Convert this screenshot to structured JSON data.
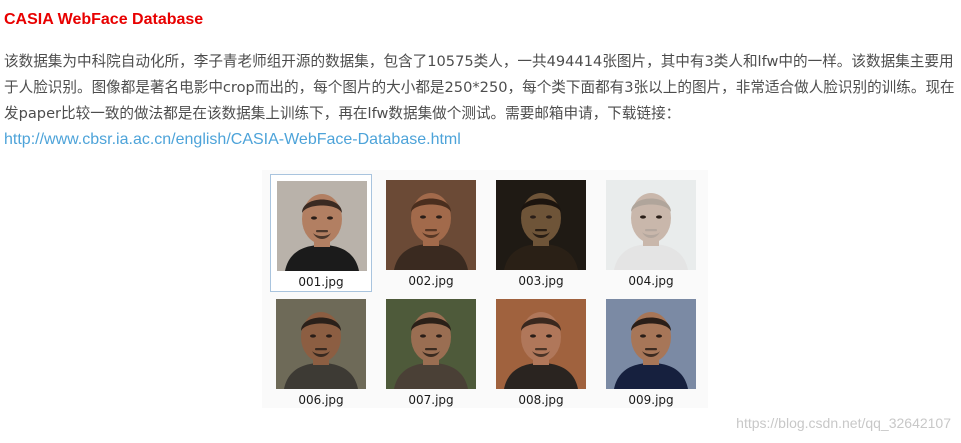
{
  "title": "CASIA WebFace Database",
  "paragraph": {
    "text": "该数据集为中科院自动化所，李子青老师组开源的数据集，包含了10575类人，一共494414张图片，其中有3类人和lfw中的一样。该数据集主要用于人脸识别。图像都是著名电影中crop而出的，每个图片的大小都是250*250，每个类下面都有3张以上的图片，非常适合做人脸识别的训练。现在发paper比较一致的做法都是在该数据集上训练下，再在lfw数据集做个测试。需要邮箱申请，下载链接：",
    "link_text": "http://www.cbsr.ia.ac.cn/english/CASIA-WebFace-Database.html"
  },
  "gallery": {
    "files": [
      {
        "name": "001.jpg",
        "selected": true,
        "bg": "#b9b2aa",
        "skin": "#b27f62",
        "hair": "#3a2a22",
        "shirt": "#1b1b1b"
      },
      {
        "name": "002.jpg",
        "selected": false,
        "bg": "#6b4a36",
        "skin": "#a26a4b",
        "hair": "#4a2e1e",
        "shirt": "#3a2a20"
      },
      {
        "name": "003.jpg",
        "selected": false,
        "bg": "#1f1a14",
        "skin": "#6e5438",
        "hair": "#1c140e",
        "shirt": "#2a2016"
      },
      {
        "name": "004.jpg",
        "selected": false,
        "bg": "#e9ecec",
        "skin": "#c9b7ab",
        "hair": "#b0a59b",
        "shirt": "#e4e4e4"
      },
      {
        "name": "006.jpg",
        "selected": false,
        "bg": "#6e6a58",
        "skin": "#8c5e42",
        "hair": "#2a201a",
        "shirt": "#3d3a34"
      },
      {
        "name": "007.jpg",
        "selected": false,
        "bg": "#4e5a3a",
        "skin": "#9a6e52",
        "hair": "#2a2018",
        "shirt": "#4a4036"
      },
      {
        "name": "008.jpg",
        "selected": false,
        "bg": "#a0623e",
        "skin": "#b0775a",
        "hair": "#3a281e",
        "shirt": "#2a2420"
      },
      {
        "name": "009.jpg",
        "selected": false,
        "bg": "#7b8aa4",
        "skin": "#a77658",
        "hair": "#2a1e18",
        "shirt": "#16203e"
      }
    ]
  },
  "watermark": "https://blog.csdn.net/qq_32642107",
  "colors": {
    "title": "#e80000",
    "body_text": "#4d4d4d",
    "link": "#4da3d9",
    "watermark": "#c8c8c8"
  }
}
